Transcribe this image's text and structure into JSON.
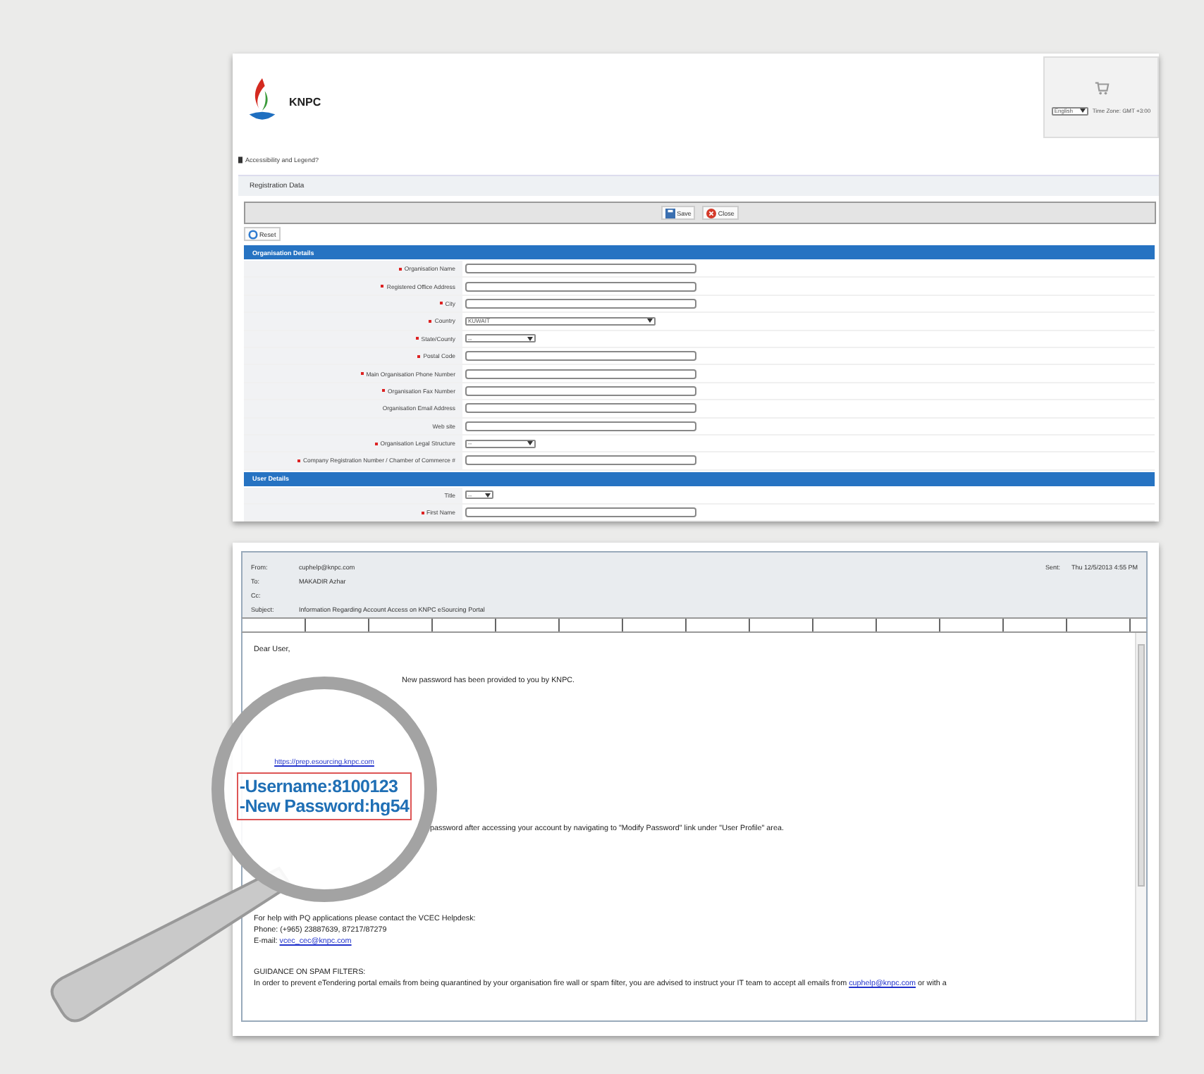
{
  "registration_page": {
    "logo_text": "KNPC",
    "language_select": {
      "value": "English"
    },
    "time_zone": "Time Zone: GMT +3:00",
    "accessibility_link": "Accessibility and Legend?",
    "section_title": "Registration Data",
    "toolbar_buttons": [
      {
        "label": "Save",
        "kind": "save"
      },
      {
        "label": "Close",
        "kind": "close"
      }
    ],
    "reset_button": "Reset",
    "sections": [
      {
        "title": "Organisation Details",
        "fields": [
          {
            "label": "Organisation Name",
            "required": true,
            "kind": "text"
          },
          {
            "label": "Registered Office Address",
            "required": true,
            "kind": "text"
          },
          {
            "label": "City",
            "required": true,
            "kind": "text"
          },
          {
            "label": "Country",
            "required": true,
            "kind": "wideselect",
            "value": "KUWAIT"
          },
          {
            "label": "State/County",
            "required": true,
            "kind": "select",
            "value": "--"
          },
          {
            "label": "Postal Code",
            "required": true,
            "kind": "text"
          },
          {
            "label": "Main Organisation Phone Number",
            "required": true,
            "kind": "text"
          },
          {
            "label": "Organisation Fax Number",
            "required": true,
            "kind": "text"
          },
          {
            "label": "Organisation Email Address",
            "required": false,
            "kind": "text"
          },
          {
            "label": "Web site",
            "required": false,
            "kind": "text"
          },
          {
            "label": "Organisation Legal Structure",
            "required": true,
            "kind": "select",
            "value": "--"
          },
          {
            "label": "Company Registration Number / Chamber of Commerce #",
            "required": true,
            "kind": "text"
          }
        ]
      },
      {
        "title": "User Details",
        "fields": [
          {
            "label": "Title",
            "required": false,
            "kind": "tinyselect",
            "value": "--"
          },
          {
            "label": "First Name",
            "required": true,
            "kind": "text"
          }
        ]
      }
    ]
  },
  "email": {
    "headers": [
      {
        "label": "From:",
        "value": "cuphelp@knpc.com"
      },
      {
        "label": "To:",
        "value": "MAKADIR Azhar"
      },
      {
        "label": "Cc:"
      },
      {
        "label": "Subject:",
        "value": "Information Regarding Account Access on KNPC eSourcing Portal"
      }
    ],
    "sent": {
      "label": "Sent:",
      "value": "Thu 12/5/2013 4:55 PM"
    },
    "body": [
      {
        "kind": "text",
        "text": "Dear User,"
      },
      {
        "kind": "fragment",
        "text": "New password has been provided to you by KNPC."
      },
      {
        "kind": "fragment",
        "text": "password after accessing your account by navigating to \"Modify Password\" link under \"User Profile\" area."
      },
      {
        "kind": "text",
        "text": "For help with PQ applications please contact the VCEC Helpdesk:"
      },
      {
        "kind": "line",
        "text": "Phone: (+965) 23887639, 87217/87279"
      },
      {
        "kind": "link",
        "text": "E-mail:",
        "link": "vcec_cec@knpc.com"
      },
      {
        "kind": "text",
        "text": "GUIDANCE ON SPAM FILTERS:"
      },
      {
        "kind": "link",
        "text": "In order to prevent eTendering portal emails from being quarantined by your organisation fire wall or spam filter, you are advised to instruct your IT team to accept all emails from",
        "link": "cuphelp@knpc.com",
        "after": "or with a"
      }
    ],
    "magnifier": {
      "link": "https://prep.esourcing.knpc.com",
      "lines": [
        "-Username:8100123",
        "-New Password:hg54"
      ]
    }
  }
}
